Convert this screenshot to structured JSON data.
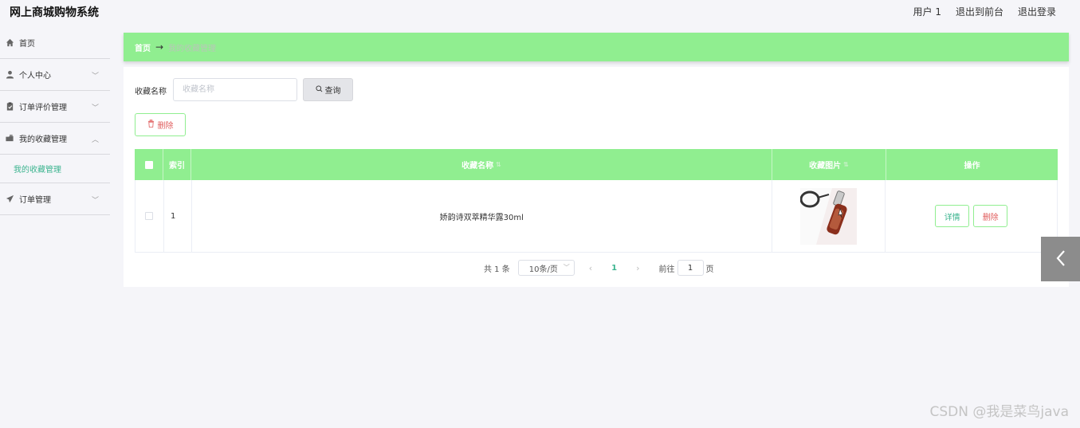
{
  "app": {
    "title": "网上商城购物系统"
  },
  "header": {
    "user": "用户 1",
    "back_to_front": "退出到前台",
    "logout": "退出登录"
  },
  "sidebar": {
    "items": [
      {
        "label": "首页",
        "icon": "home-icon"
      },
      {
        "label": "个人中心",
        "icon": "user-icon"
      },
      {
        "label": "订单评价管理",
        "icon": "clipboard-icon"
      },
      {
        "label": "我的收藏管理",
        "icon": "folder-icon"
      },
      {
        "label": "订单管理",
        "icon": "send-icon"
      }
    ],
    "submenu": {
      "label": "我的收藏管理"
    }
  },
  "breadcrumb": {
    "home": "首页",
    "arrow": "→",
    "current": "我的收藏管理"
  },
  "search": {
    "label": "收藏名称",
    "placeholder": "收藏名称",
    "query_button": "查询"
  },
  "toolbar": {
    "delete_button": "删除"
  },
  "table": {
    "headers": [
      "",
      "索引",
      "收藏名称",
      "收藏图片",
      "操作"
    ],
    "rows": [
      {
        "index": "1",
        "name": "娇韵诗双萃精华露30ml",
        "image": "product-thumbnail",
        "detail": "详情",
        "delete": "删除"
      }
    ]
  },
  "pagination": {
    "total": "共 1 条",
    "page_size": "10条/页",
    "current_page": "1",
    "goto_label": "前往",
    "goto_value": "1",
    "page_suffix": "页"
  },
  "watermark": "CSDN @我是菜鸟java",
  "colors": {
    "accent": "#90ee90",
    "link": "#3cb48f",
    "danger": "#e05d5d"
  }
}
